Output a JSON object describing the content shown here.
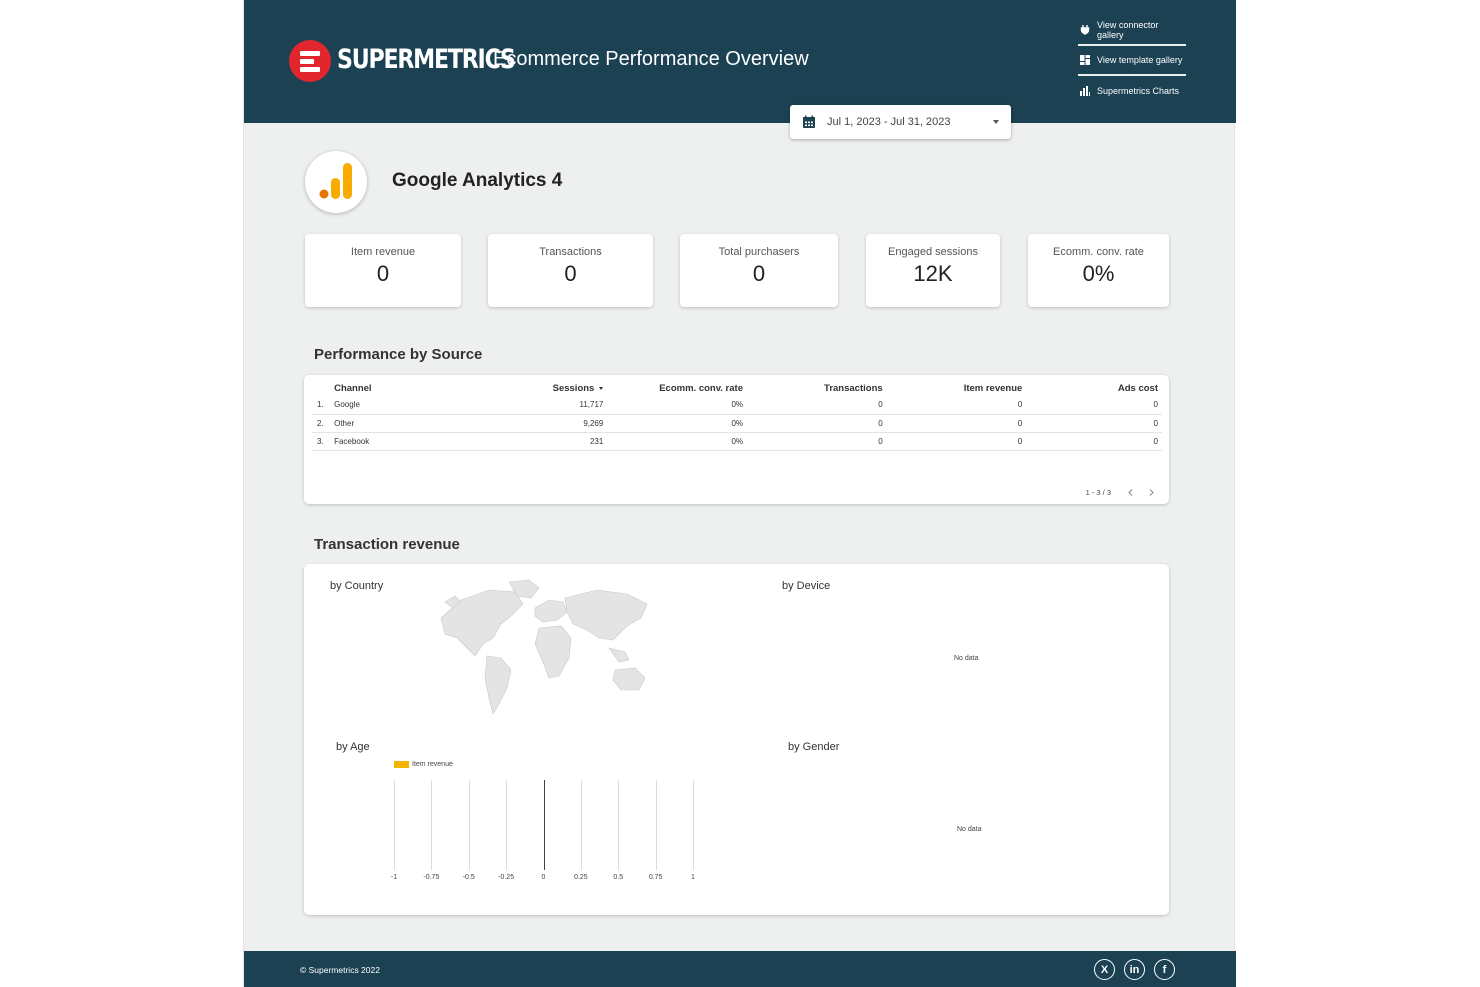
{
  "header": {
    "brand": "SUPERMETRICS",
    "title": "Ecommerce Performance Overview",
    "links": [
      {
        "label": "View connector gallery",
        "icon": "plug-icon"
      },
      {
        "label": "View template gallery",
        "icon": "template-icon"
      },
      {
        "label": "Supermetrics Charts",
        "icon": "bar-chart-icon"
      }
    ],
    "date_range": "Jul 1, 2023 - Jul 31, 2023"
  },
  "source": {
    "name": "Google Analytics 4"
  },
  "kpis": [
    {
      "label": "Item revenue",
      "value": "0"
    },
    {
      "label": "Transactions",
      "value": "0"
    },
    {
      "label": "Total purchasers",
      "value": "0"
    },
    {
      "label": "Engaged sessions",
      "value": "12K"
    },
    {
      "label": "Ecomm. conv. rate",
      "value": "0%"
    }
  ],
  "performance": {
    "title": "Performance by Source",
    "columns": [
      "Channel",
      "Sessions",
      "Ecomm. conv. rate",
      "Transactions",
      "Item revenue",
      "Ads cost"
    ],
    "rows": [
      {
        "num": "1.",
        "channel": "Google",
        "sessions": "11,717",
        "conv": "0%",
        "transactions": "0",
        "revenue": "0",
        "ads": "0"
      },
      {
        "num": "2.",
        "channel": "Other",
        "sessions": "9,269",
        "conv": "0%",
        "transactions": "0",
        "revenue": "0",
        "ads": "0"
      },
      {
        "num": "3.",
        "channel": "Facebook",
        "sessions": "231",
        "conv": "0%",
        "transactions": "0",
        "revenue": "0",
        "ads": "0"
      }
    ],
    "pager": "1 - 3 / 3"
  },
  "revenue": {
    "title": "Transaction revenue",
    "by_country": "by Country",
    "by_device": "by Device",
    "by_age": "by Age",
    "by_gender": "by Gender",
    "no_data_device": "No data",
    "no_data_gender": "No data",
    "age_legend": "Item revenue",
    "age_ticks": [
      "-1",
      "-0.75",
      "-0.5",
      "-0.25",
      "0",
      "0.25",
      "0.5",
      "0.75",
      "1"
    ]
  },
  "footer": {
    "copyright": "© Supermetrics 2022",
    "social": [
      {
        "glyph": "X",
        "icon": "x-twitter-icon"
      },
      {
        "glyph": "in",
        "icon": "linkedin-icon"
      },
      {
        "glyph": "f",
        "icon": "facebook-icon"
      }
    ]
  },
  "colors": {
    "header_bg": "#1b4152",
    "brand_red": "#e3262d",
    "page_bg": "#edf0ef",
    "ga_orange": "#f9ab00",
    "ga_dark_orange": "#e37400",
    "age_series": "#f4b400"
  }
}
